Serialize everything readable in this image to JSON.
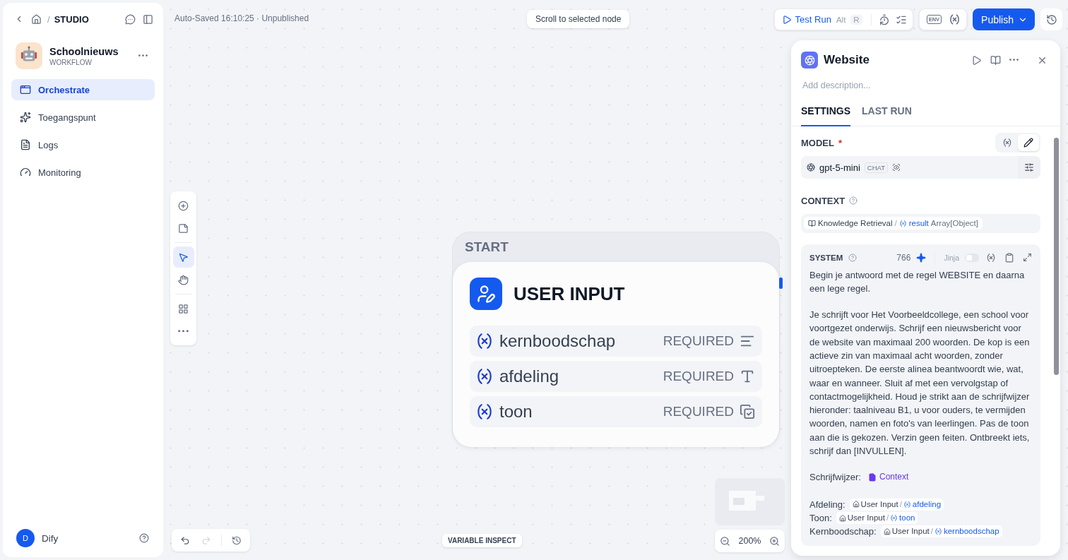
{
  "sidebar": {
    "breadcrumb_separator": "/",
    "breadcrumb": "STUDIO",
    "app": {
      "name": "Schoolnieuws",
      "type": "WORKFLOW"
    },
    "nav": [
      {
        "label": "Orchestrate",
        "kind": "orchestrate",
        "selected": true
      },
      {
        "label": "Toegangspunt",
        "kind": "access",
        "selected": false
      },
      {
        "label": "Logs",
        "kind": "logs",
        "selected": false
      },
      {
        "label": "Monitoring",
        "kind": "monitoring",
        "selected": false
      }
    ],
    "user": {
      "initial": "D",
      "name": "Dify"
    }
  },
  "header": {
    "status": "Auto-Saved 16:10:25 · Unpublished",
    "hint": "Scroll to selected node",
    "test_run": {
      "label": "Test Run",
      "keys": [
        "Alt",
        "R"
      ]
    },
    "env": "ENV",
    "publish": "Publish"
  },
  "canvas_tools": [
    {
      "kind": "add",
      "selected": false
    },
    {
      "kind": "note",
      "selected": false
    },
    {
      "kind": "pointer",
      "selected": true
    },
    {
      "kind": "hand",
      "selected": false
    },
    {
      "kind": "organize",
      "selected": false
    },
    {
      "kind": "more",
      "selected": false
    }
  ],
  "node": {
    "group": "START",
    "title": "USER INPUT",
    "variables": [
      {
        "name": "kernboodschap",
        "badge": "REQUIRED",
        "kind": "paragraph"
      },
      {
        "name": "afdeling",
        "badge": "REQUIRED",
        "kind": "text"
      },
      {
        "name": "toon",
        "badge": "REQUIRED",
        "kind": "select"
      }
    ]
  },
  "history": [
    {
      "kind": "undo",
      "disabled": false
    },
    {
      "kind": "redo",
      "disabled": true
    }
  ],
  "variable_inspect": "VARIABLE INSPECT",
  "zoom": "200%",
  "panel": {
    "title": "Website",
    "description_placeholder": "Add description...",
    "tabs": [
      {
        "label": "SETTINGS",
        "selected": true
      },
      {
        "label": "LAST RUN",
        "selected": false
      }
    ],
    "model": {
      "label": "MODEL",
      "required_mark": "*",
      "modes": [
        {
          "kind": "variable",
          "selected": false
        },
        {
          "kind": "edit",
          "selected": true
        }
      ],
      "name": "gpt-5-mini",
      "badge": "CHAT"
    },
    "context": {
      "label": "CONTEXT",
      "source": "Knowledge Retrieval",
      "separator": "/",
      "variable": "result",
      "type": "Array[Object]"
    },
    "system": {
      "label": "SYSTEM",
      "count": "766",
      "jinja": {
        "label": "Jinja",
        "on": false
      },
      "prompt": [
        {
          "kind": "text",
          "text": "Begin je antwoord met de regel WEBSITE en daarna een lege regel."
        },
        {
          "kind": "text",
          "text": "Je schrijft voor Het Voorbeeldcollege, een school voor voortgezet onderwijs. Schrijf een nieuwsbericht voor de website van maximaal 200 woorden. De kop is een actieve zin van maximaal acht woorden, zonder uitroepteken. De eerste alinea beantwoordt wie, wat, waar en wanneer. Sluit af met een vervolgstap of contactmogelijkheid. Houd je strikt aan de schrijfwijzer hieronder: taalniveau B1, u voor ouders, te vermijden woorden, namen en foto's van leerlingen. Pas de toon aan die is gekozen. Verzin geen feiten. Ontbreekt iets, schrijf dan [INVULLEN]."
        },
        {
          "kind": "context",
          "label": "Schrijfwijzer:",
          "chip": "Context"
        },
        {
          "kind": "refs",
          "lines": [
            {
              "label": "Afdeling:",
              "node": "User Input",
              "separator": "/",
              "variable": "afdeling"
            },
            {
              "label": "Toon:",
              "node": "User Input",
              "separator": "/",
              "variable": "toon"
            },
            {
              "label": "Kernboodschap:",
              "node": "User Input",
              "separator": "/",
              "variable": "kernboodschap"
            }
          ]
        }
      ]
    }
  }
}
